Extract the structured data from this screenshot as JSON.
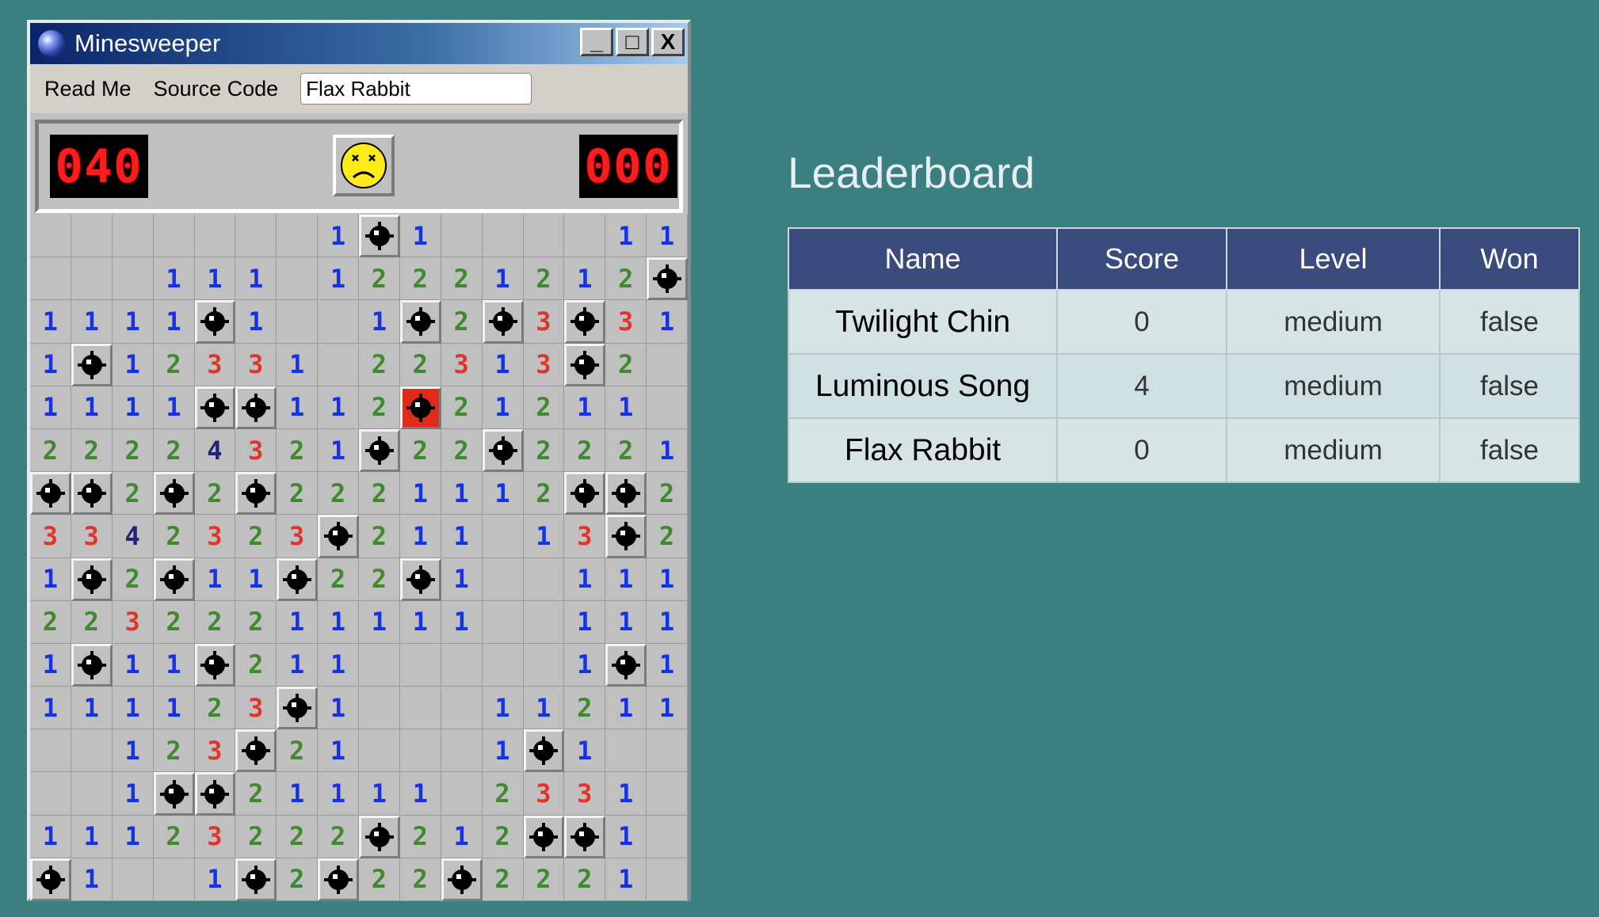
{
  "window": {
    "title": "Minesweeper",
    "buttons": {
      "minimize": "_",
      "maximize": "□",
      "close": "X"
    }
  },
  "menu": {
    "items": [
      "Read Me",
      "Source Code"
    ],
    "player_name": "Flax Rabbit"
  },
  "game": {
    "mines_counter": "040",
    "timer": "000",
    "face": "dead",
    "rows": [
      [
        "",
        "",
        "",
        "",
        "",
        "",
        "",
        "1",
        "*",
        "1",
        "",
        "",
        "",
        "",
        "1",
        "1"
      ],
      [
        "",
        "",
        "",
        "1",
        "1",
        "1",
        "",
        "1",
        "2",
        "2",
        "2",
        "1",
        "2",
        "1",
        "2",
        "*"
      ],
      [
        "1",
        "1",
        "1",
        "1",
        "*",
        "1",
        "",
        "",
        "1",
        "*",
        "2",
        "*",
        "3",
        "*",
        "3",
        "1"
      ],
      [
        "1",
        "*",
        "1",
        "2",
        "3",
        "3",
        "1",
        "",
        "2",
        "2",
        "3",
        "1",
        "3",
        "*",
        "2",
        ""
      ],
      [
        "1",
        "1",
        "1",
        "1",
        "*",
        "*",
        "1",
        "1",
        "2",
        "X",
        "2",
        "1",
        "2",
        "1",
        "1",
        ""
      ],
      [
        "2",
        "2",
        "2",
        "2",
        "4",
        "3",
        "2",
        "1",
        "*",
        "2",
        "2",
        "*",
        "2",
        "2",
        "2",
        "1"
      ],
      [
        "*",
        "*",
        "2",
        "*",
        "2",
        "*",
        "2",
        "2",
        "2",
        "1",
        "1",
        "1",
        "2",
        "*",
        "*",
        "2"
      ],
      [
        "3",
        "3",
        "4",
        "2",
        "3",
        "2",
        "3",
        "*",
        "2",
        "1",
        "1",
        "",
        "1",
        "3",
        "*",
        "2"
      ],
      [
        "1",
        "*",
        "2",
        "*",
        "1",
        "1",
        "*",
        "2",
        "2",
        "*",
        "1",
        "",
        "",
        "1",
        "1",
        "1"
      ],
      [
        "2",
        "2",
        "3",
        "2",
        "2",
        "2",
        "1",
        "1",
        "1",
        "1",
        "1",
        "",
        "",
        "1",
        "1",
        "1"
      ],
      [
        "1",
        "*",
        "1",
        "1",
        "*",
        "2",
        "1",
        "1",
        "",
        "",
        "",
        "",
        "",
        "1",
        "*",
        "1"
      ],
      [
        "1",
        "1",
        "1",
        "1",
        "2",
        "3",
        "*",
        "1",
        "",
        "",
        "",
        "1",
        "1",
        "2",
        "1",
        "1"
      ],
      [
        "",
        "",
        "1",
        "2",
        "3",
        "*",
        "2",
        "1",
        "",
        "",
        "",
        "1",
        "*",
        "1",
        "",
        ""
      ],
      [
        "",
        "",
        "1",
        "*",
        "*",
        "2",
        "1",
        "1",
        "1",
        "1",
        "",
        "2",
        "3",
        "3",
        "1",
        ""
      ],
      [
        "1",
        "1",
        "1",
        "2",
        "3",
        "2",
        "2",
        "2",
        "*",
        "2",
        "1",
        "2",
        "*",
        "*",
        "1",
        ""
      ],
      [
        "*",
        "1",
        "",
        "",
        "1",
        "*",
        "2",
        "*",
        "2",
        "2",
        "*",
        "2",
        "2",
        "2",
        "1",
        ""
      ]
    ]
  },
  "leaderboard": {
    "title": "Leaderboard",
    "columns": [
      "Name",
      "Score",
      "Level",
      "Won"
    ],
    "rows": [
      [
        "Twilight Chin",
        "0",
        "medium",
        "false"
      ],
      [
        "Luminous Song",
        "4",
        "medium",
        "false"
      ],
      [
        "Flax Rabbit",
        "0",
        "medium",
        "false"
      ]
    ]
  }
}
